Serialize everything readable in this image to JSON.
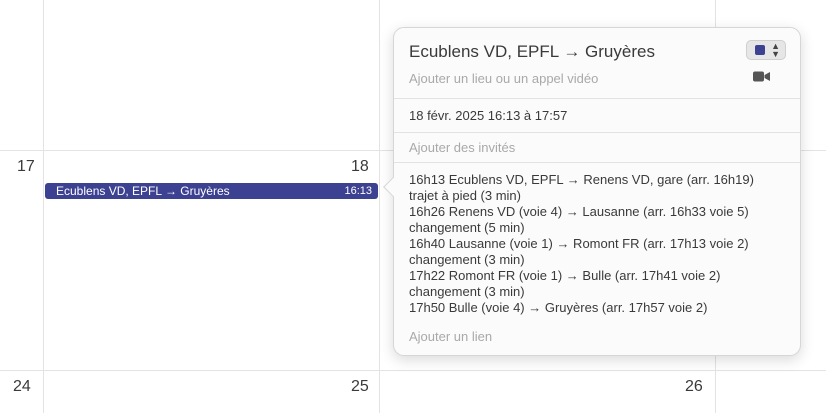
{
  "calendar": {
    "days": [
      {
        "num": "17"
      },
      {
        "num": "18"
      },
      {
        "num": "24"
      },
      {
        "num": "25"
      },
      {
        "num": "26"
      }
    ]
  },
  "event": {
    "title": "Ecublens VD, EPFL → Gruyères",
    "time": "16:13",
    "color": "#3d4191"
  },
  "popover": {
    "title": "Ecublens VD, EPFL → Gruyères",
    "location_placeholder": "Ajouter un lieu ou un appel vidéo",
    "video_icon": "video-camera-icon",
    "datetime": "18 févr. 2025  16:13 à 17:57",
    "invitees_placeholder": "Ajouter des invités",
    "notes": [
      "16h13 Ecublens VD, EPFL → Renens VD, gare (arr. 16h19)",
      "trajet à pied (3 min)",
      "16h26 Renens VD (voie 4) → Lausanne (arr. 16h33 voie 5)",
      "changement (5 min)",
      "16h40 Lausanne (voie 1) → Romont FR (arr. 17h13 voie 2)",
      "changement (3 min)",
      "17h22 Romont FR (voie 1) → Bulle (arr. 17h41 voie 2)",
      "changement (3 min)",
      "17h50 Bulle (voie 4) → Gruyères (arr. 17h57 voie 2)"
    ],
    "link_placeholder": "Ajouter un lien",
    "calendar_color": "#3d4191"
  }
}
